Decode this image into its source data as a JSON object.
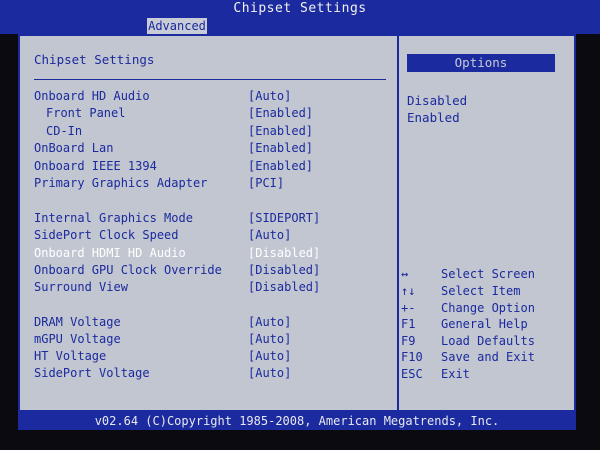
{
  "title": "Chipset Settings",
  "active_tab": "Advanced",
  "pane_title": "Chipset Settings",
  "settings": [
    {
      "label": "Onboard HD Audio",
      "value": "[Auto]"
    },
    {
      "label": "Front Panel",
      "value": "[Enabled]",
      "indent": true
    },
    {
      "label": "CD-In",
      "value": "[Enabled]",
      "indent": true
    },
    {
      "label": "OnBoard Lan",
      "value": "[Enabled]"
    },
    {
      "label": "Onboard IEEE 1394",
      "value": "[Enabled]"
    },
    {
      "label": "Primary Graphics Adapter",
      "value": "[PCI]"
    },
    {
      "label": "Internal Graphics Mode",
      "value": "[SIDEPORT]"
    },
    {
      "label": "SidePort Clock Speed",
      "value": "[Auto]"
    },
    {
      "label": "Onboard HDMI HD Audio",
      "value": "[Disabled]",
      "selected": true
    },
    {
      "label": "Onboard GPU Clock Override",
      "value": "[Disabled]"
    },
    {
      "label": "Surround View",
      "value": "[Disabled]"
    },
    {
      "label": "DRAM Voltage",
      "value": "[Auto]"
    },
    {
      "label": "mGPU Voltage",
      "value": "[Auto]"
    },
    {
      "label": "HT Voltage",
      "value": "[Auto]"
    },
    {
      "label": "SidePort Voltage",
      "value": "[Auto]"
    }
  ],
  "options_header": "Options",
  "options": [
    "Disabled",
    "Enabled"
  ],
  "help": [
    {
      "key": "↔",
      "text": "Select Screen"
    },
    {
      "key": "↑↓",
      "text": "Select Item"
    },
    {
      "key": "+-",
      "text": "Change Option"
    },
    {
      "key": "F1",
      "text": "General Help"
    },
    {
      "key": "F9",
      "text": "Load Defaults"
    },
    {
      "key": "F10",
      "text": "Save and Exit"
    },
    {
      "key": "ESC",
      "text": "Exit"
    }
  ],
  "footer": "v02.64 (C)Copyright 1985-2008, American Megatrends, Inc."
}
